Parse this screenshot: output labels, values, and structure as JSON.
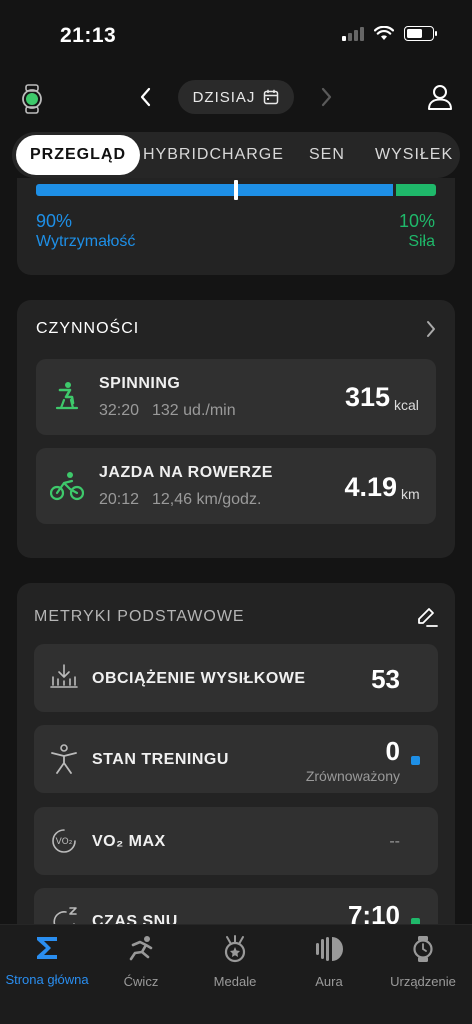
{
  "status_bar": {
    "time": "21:13"
  },
  "top_nav": {
    "date_label": "DZISIAJ"
  },
  "tabs": [
    {
      "label": "PRZEGLĄD",
      "active": true
    },
    {
      "label": "HYBRIDCHARGE",
      "active": false
    },
    {
      "label": "SEN",
      "active": false
    },
    {
      "label": "WYSIŁEK",
      "active": false
    }
  ],
  "balance": {
    "endurance_pct": "90%",
    "endurance_label": "Wytrzymałość",
    "strength_pct": "10%",
    "strength_label": "Siła",
    "endurance_fraction": 0.9,
    "marker_fraction": 0.5,
    "colors": {
      "endurance": "#1e8fe6",
      "strength": "#1fb86a"
    }
  },
  "activities": {
    "title": "CZYNNOŚCI",
    "items": [
      {
        "name": "SPINNING",
        "duration": "32:20",
        "detail": "132 ud./min",
        "value": "315",
        "unit": "kcal",
        "icon": "spinning-bike-icon"
      },
      {
        "name": "JAZDA NA ROWERZE",
        "duration": "20:12",
        "detail": "12,46 km/godz.",
        "value": "4.19",
        "unit": "km",
        "icon": "cycling-icon"
      }
    ]
  },
  "metrics": {
    "title": "METRYKI PODSTAWOWE",
    "items": [
      {
        "name": "OBCIĄŻENIE WYSIŁKOWE",
        "value": "53",
        "sub": "",
        "icon": "training-load-icon"
      },
      {
        "name": "STAN TRENINGU",
        "value": "0",
        "sub": "Zrównoważony",
        "icon": "training-status-icon",
        "status_color": "#1e8fe6"
      },
      {
        "name": "VO₂ MAX",
        "value": "--",
        "sub": "",
        "icon": "vo2max-icon"
      },
      {
        "name": "CZAS SNU",
        "value": "7:10",
        "sub": "",
        "icon": "sleep-icon",
        "status_color": "#1fb86a"
      }
    ]
  },
  "bottom_nav": [
    {
      "label": "Strona główna",
      "active": true,
      "icon": "sigma-icon"
    },
    {
      "label": "Ćwicz",
      "active": false,
      "icon": "running-icon"
    },
    {
      "label": "Medale",
      "active": false,
      "icon": "medal-icon"
    },
    {
      "label": "Aura",
      "active": false,
      "icon": "aura-icon"
    },
    {
      "label": "Urządzenie",
      "active": false,
      "icon": "watch-icon"
    }
  ],
  "colors": {
    "accent": "#2a8ef0",
    "background": "#141414",
    "card": "#232323"
  }
}
